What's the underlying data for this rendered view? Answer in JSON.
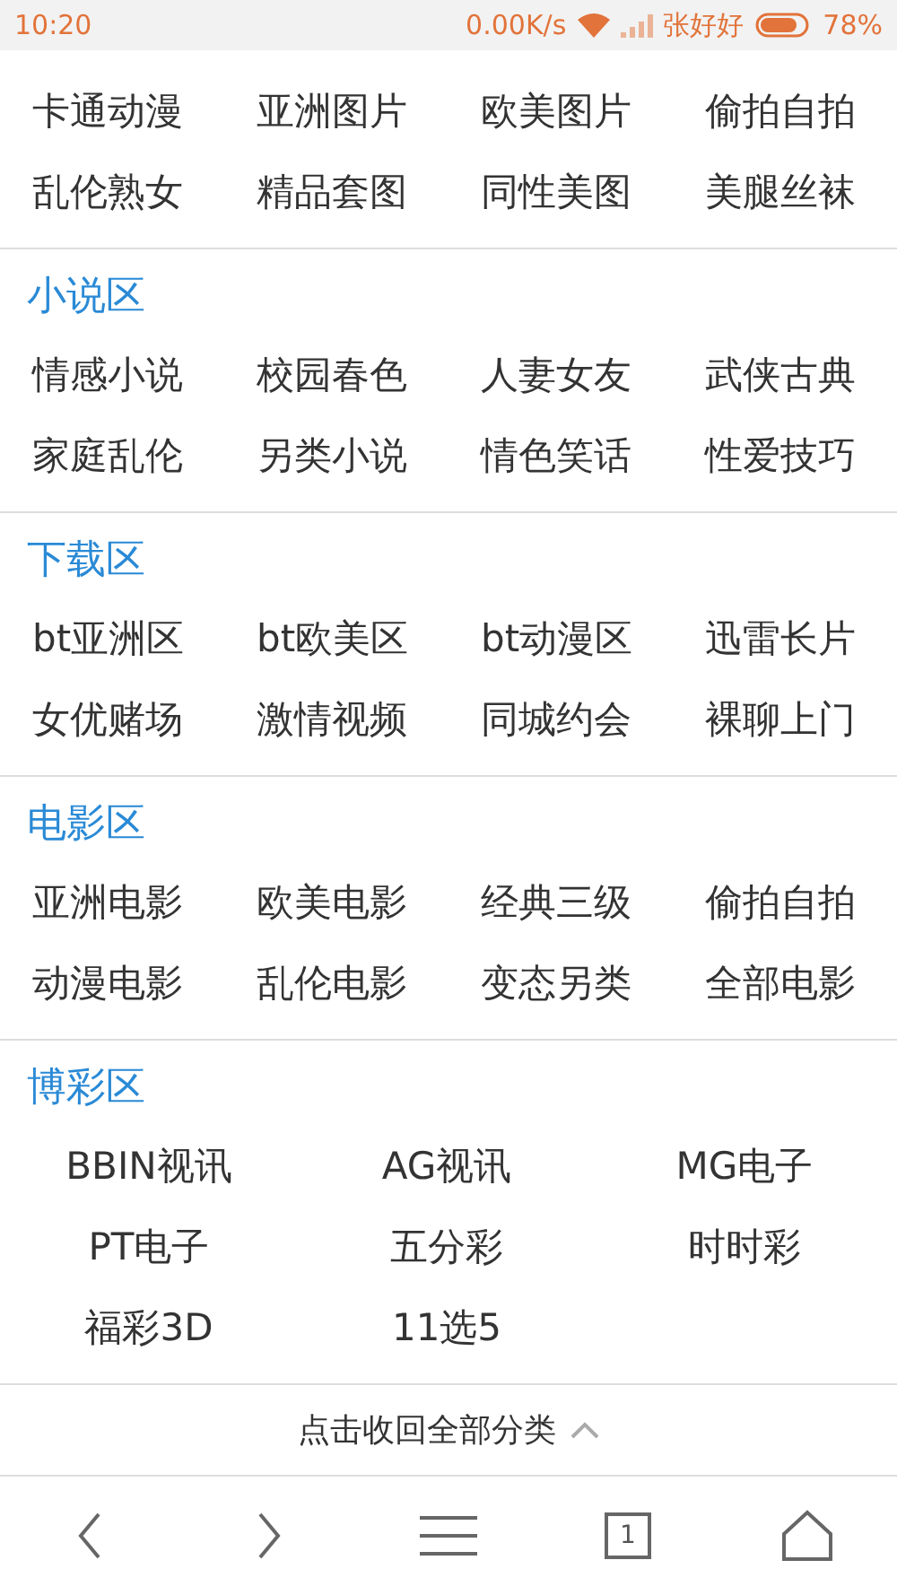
{
  "status_bar": {
    "time": "10:20",
    "speed": "0.00K/s",
    "carrier": "张好好",
    "battery": "78%"
  },
  "sections": [
    {
      "kind": "grid",
      "items": [
        "卡通动漫",
        "亚洲图片",
        "欧美图片",
        "偷拍自拍",
        "乱伦熟女",
        "精品套图",
        "同性美图",
        "美腿丝袜"
      ]
    },
    {
      "kind": "grid",
      "title": "小说区",
      "items": [
        "情感小说",
        "校园春色",
        "人妻女友",
        "武侠古典",
        "家庭乱伦",
        "另类小说",
        "情色笑话",
        "性爱技巧"
      ]
    },
    {
      "kind": "grid",
      "title": "下载区",
      "items": [
        "bt亚洲区",
        "bt欧美区",
        "bt动漫区",
        "迅雷长片",
        "女优赌场",
        "激情视频",
        "同城约会",
        "裸聊上门"
      ]
    },
    {
      "kind": "grid",
      "title": "电影区",
      "items": [
        "亚洲电影",
        "欧美电影",
        "经典三级",
        "偷拍自拍",
        "动漫电影",
        "乱伦电影",
        "变态另类",
        "全部电影"
      ]
    },
    {
      "kind": "centered",
      "title": "博彩区",
      "items": [
        "BBIN视讯",
        "AG视讯",
        "MG电子",
        "PT电子",
        "五分彩",
        "时时彩",
        "福彩3D",
        "11选5"
      ]
    }
  ],
  "collapse_link": "点击收回全部分类",
  "nav": {
    "tab_count": "1"
  }
}
